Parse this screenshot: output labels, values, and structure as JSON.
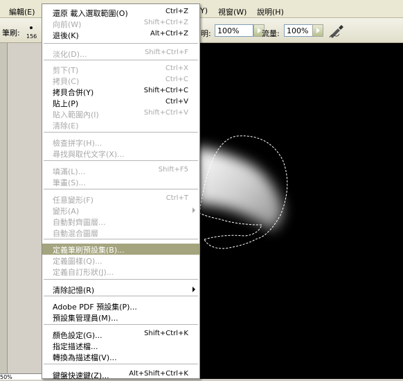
{
  "menubar": {
    "edit_menu": "編輯(E)",
    "partial_item": "Y)",
    "window_menu": "視窗(W)",
    "help_menu": "說明(H)"
  },
  "options": {
    "brush_label": "筆刷:",
    "brush_size": "156",
    "opacity_label_partial": "明:",
    "opacity_value": "100%",
    "flow_label": "流量:",
    "flow_value": "100%"
  },
  "status": {
    "zoom_partial": "50%"
  },
  "edit_menu": {
    "items": [
      {
        "label": "還原 載入選取範圍(O)",
        "shortcut": "Ctrl+Z",
        "disabled": false
      },
      {
        "label": "向前(W)",
        "shortcut": "Shift+Ctrl+Z",
        "disabled": true
      },
      {
        "label": "退後(K)",
        "shortcut": "Alt+Ctrl+Z",
        "disabled": false
      },
      {
        "label": "淡化(D)...",
        "shortcut": "Shift+Ctrl+F",
        "disabled": true
      },
      {
        "label": "剪下(T)",
        "shortcut": "Ctrl+X",
        "disabled": true
      },
      {
        "label": "拷貝(C)",
        "shortcut": "Ctrl+C",
        "disabled": true
      },
      {
        "label": "拷貝合併(Y)",
        "shortcut": "Shift+Ctrl+C",
        "disabled": false
      },
      {
        "label": "貼上(P)",
        "shortcut": "Ctrl+V",
        "disabled": false
      },
      {
        "label": "貼入範圍內(I)",
        "shortcut": "Shift+Ctrl+V",
        "disabled": true
      },
      {
        "label": "清除(E)",
        "shortcut": "",
        "disabled": true
      },
      {
        "label": "檢查拼字(H)...",
        "shortcut": "",
        "disabled": true
      },
      {
        "label": "尋找與取代文字(X)...",
        "shortcut": "",
        "disabled": true
      },
      {
        "label": "填滿(L)...",
        "shortcut": "Shift+F5",
        "disabled": true
      },
      {
        "label": "筆畫(S)...",
        "shortcut": "",
        "disabled": true
      },
      {
        "label": "任意變形(F)",
        "shortcut": "Ctrl+T",
        "disabled": true
      },
      {
        "label": "變形(A)",
        "shortcut": "",
        "disabled": true,
        "submenu": true
      },
      {
        "label": "自動對齊圖層...",
        "shortcut": "",
        "disabled": true
      },
      {
        "label": "自動混合圖層",
        "shortcut": "",
        "disabled": true
      },
      {
        "label": "定義筆刷預設集(B)...",
        "shortcut": "",
        "disabled": false,
        "highlighted": true
      },
      {
        "label": "定義圖樣(Q)...",
        "shortcut": "",
        "disabled": true
      },
      {
        "label": "定義自訂形狀(J)...",
        "shortcut": "",
        "disabled": true
      },
      {
        "label": "清除記憶(R)",
        "shortcut": "",
        "disabled": false,
        "submenu": true
      },
      {
        "label": "Adobe PDF 預設集(P)...",
        "shortcut": "",
        "disabled": false
      },
      {
        "label": "預設集管理員(M)...",
        "shortcut": "",
        "disabled": false
      },
      {
        "label": "顏色設定(G)...",
        "shortcut": "Shift+Ctrl+K",
        "disabled": false
      },
      {
        "label": "指定描述檔...",
        "shortcut": "",
        "disabled": false
      },
      {
        "label": "轉換為描述檔(V)...",
        "shortcut": "",
        "disabled": false
      },
      {
        "label": "鍵盤快速鍵(Z)...",
        "shortcut": "Alt+Shift+Ctrl+K",
        "disabled": false
      }
    ]
  }
}
